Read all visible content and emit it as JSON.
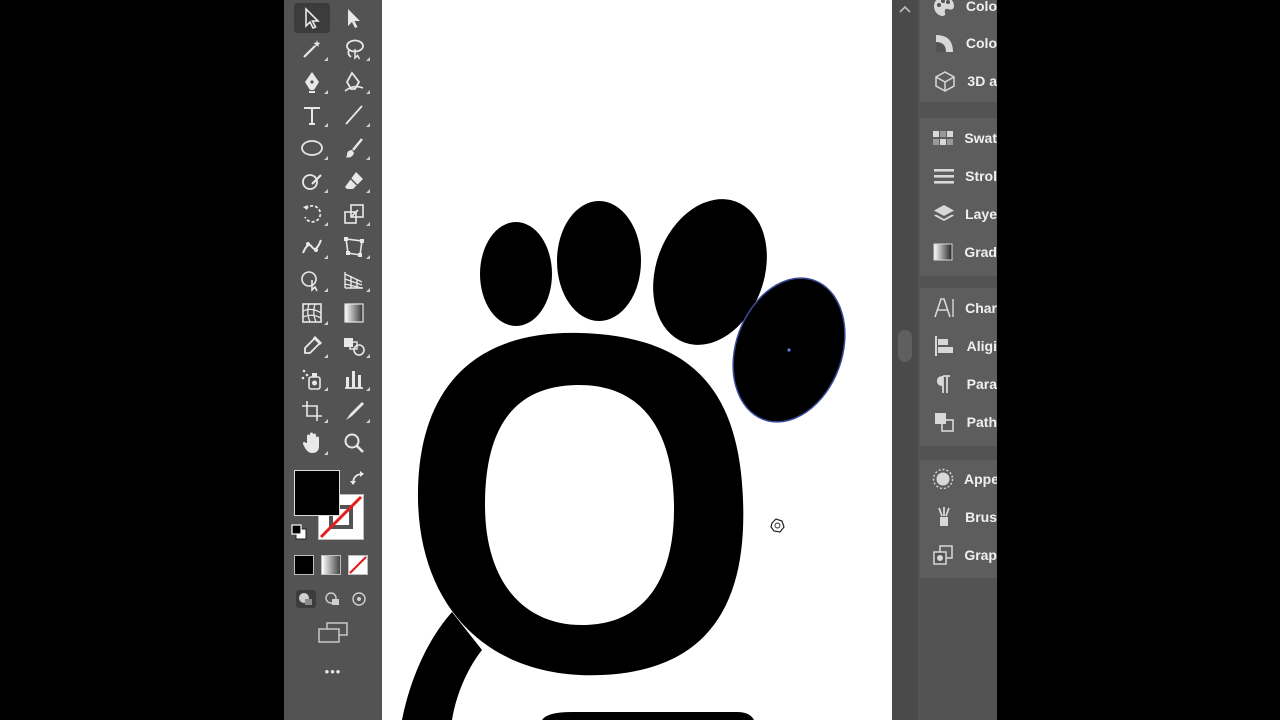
{
  "toolbar": {
    "more_tools_label": "•••"
  },
  "swatches": {
    "fill_color": "#000000",
    "stroke_color": "none"
  },
  "panels": [
    {
      "icon": "color-guide-icon",
      "label": "Colo"
    },
    {
      "icon": "color-icon",
      "label": "Colo"
    },
    {
      "icon": "3d-icon",
      "label": "3D a"
    },
    {
      "icon": "swatches-icon",
      "label": "Swat"
    },
    {
      "icon": "stroke-icon",
      "label": "Strol"
    },
    {
      "icon": "layers-icon",
      "label": "Laye"
    },
    {
      "icon": "gradient-icon",
      "label": "Grad"
    },
    {
      "icon": "character-icon",
      "label": "Char"
    },
    {
      "icon": "align-icon",
      "label": "Aligi"
    },
    {
      "icon": "paragraph-icon",
      "label": "Para"
    },
    {
      "icon": "pathfinder-icon",
      "label": "Path"
    },
    {
      "icon": "appearance-icon",
      "label": "Appe"
    },
    {
      "icon": "brushes-icon",
      "label": "Brus"
    },
    {
      "icon": "graphic-styles-icon",
      "label": "Grap"
    }
  ]
}
